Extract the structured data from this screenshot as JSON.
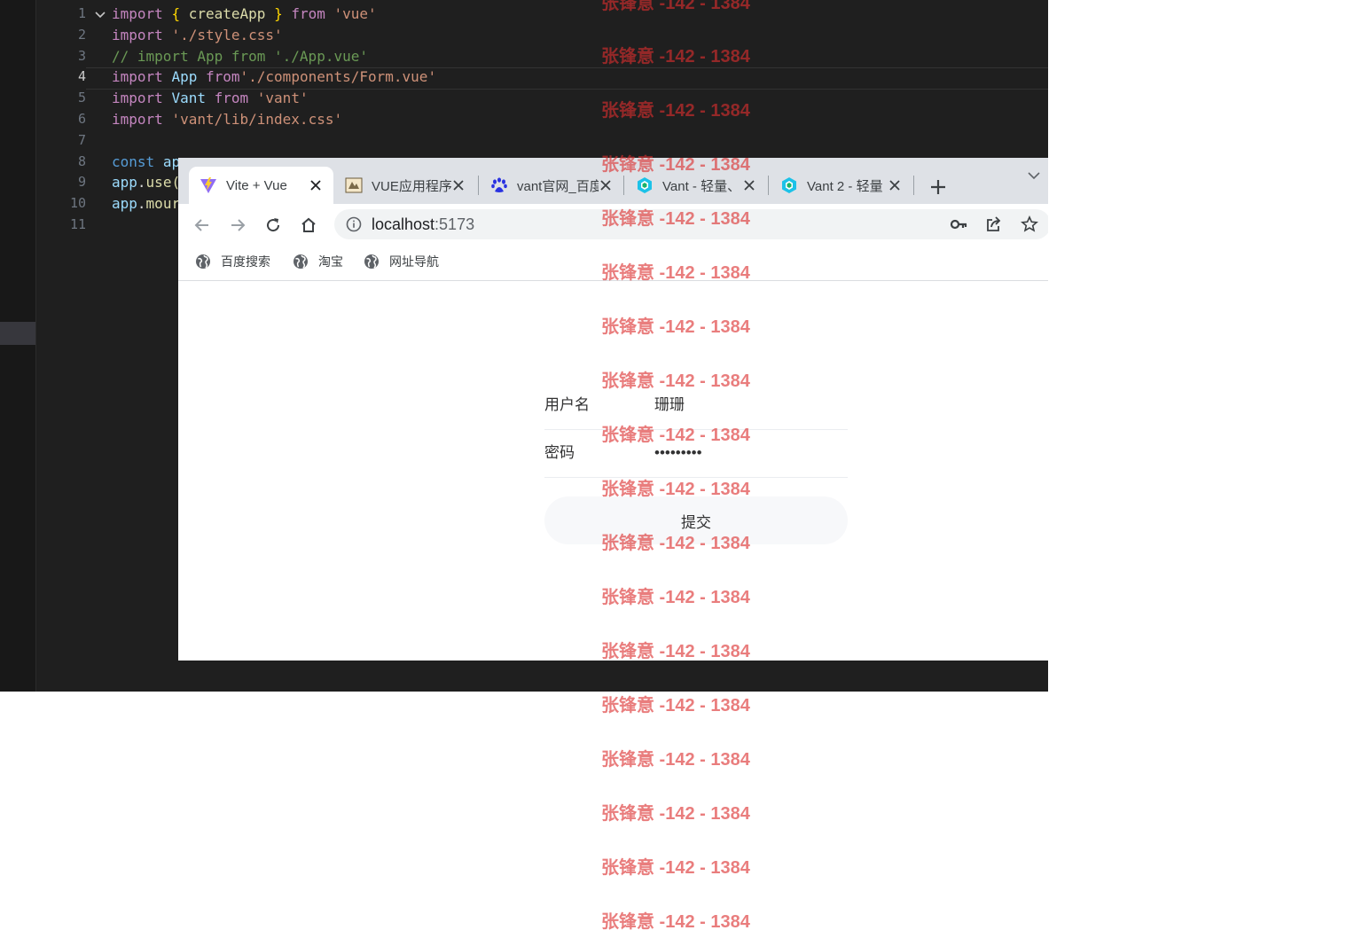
{
  "editor": {
    "line_numbers": [
      "1",
      "2",
      "3",
      "4",
      "5",
      "6",
      "7",
      "8",
      "9",
      "10",
      "11"
    ],
    "active_line": "4",
    "code": {
      "l1": {
        "kw1": "import",
        "ob": "{",
        "v": "createApp",
        "cb": "}",
        "kw2": "from",
        "s": "'vue'"
      },
      "l2": {
        "kw": "import",
        "s": "'./style.css'"
      },
      "l3": {
        "c": "// import App from './App.vue'"
      },
      "l4": {
        "kw": "import",
        "v": "App",
        "kw2": "from",
        "s": "'./components/Form.vue'"
      },
      "l5": {
        "kw": "import",
        "v": "Vant",
        "kw2": "from",
        "s": "'vant'"
      },
      "l6": {
        "kw": "import",
        "s": "'vant/lib/index.css'"
      },
      "l8": {
        "k": "const",
        "v": "ap"
      },
      "l9": {
        "v": "app",
        "p": ".",
        "f": "use("
      },
      "l10": {
        "v": "app",
        "p": ".",
        "f": "mour"
      }
    }
  },
  "browser": {
    "tabs": [
      {
        "title": "Vite + Vue",
        "favicon": "vite-logo-icon",
        "active": true
      },
      {
        "title": "VUE应用程序",
        "favicon": "document-icon",
        "active": false
      },
      {
        "title": "vant官网_百度",
        "favicon": "baidu-paw-icon",
        "active": false
      },
      {
        "title": "Vant - 轻量、",
        "favicon": "vant-logo-icon",
        "active": false
      },
      {
        "title": "Vant 2 - 轻量",
        "favicon": "vant-logo-icon",
        "active": false
      }
    ],
    "url": {
      "host": "localhost",
      "port": ":5173"
    },
    "bookmarks": [
      "百度搜索",
      "淘宝",
      "网址导航"
    ]
  },
  "form": {
    "username": {
      "label": "用户名",
      "value": "珊珊"
    },
    "password": {
      "label": "密码",
      "value": "•••••••••"
    },
    "submit_label": "提交"
  },
  "watermark": {
    "text": "张锋意 -142 - 1384",
    "color": "#dc2f2f"
  }
}
